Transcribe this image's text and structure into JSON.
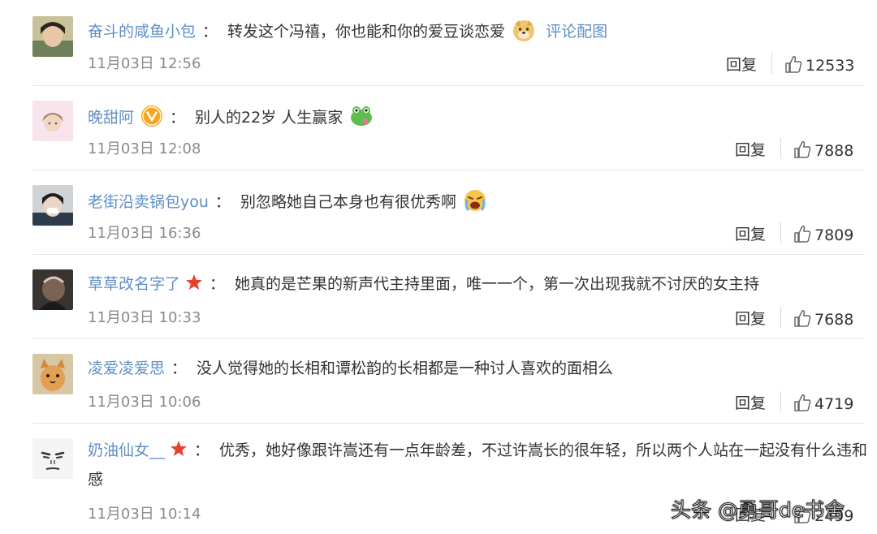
{
  "comments": [
    {
      "username": "奋斗的咸鱼小包",
      "colon": "：",
      "text": "转发这个冯禧，你也能和你的爱豆谈恋爱",
      "link": "评论配图",
      "time": "11月03日 12:56",
      "reply": "回复",
      "likes": "12533"
    },
    {
      "username": "晚甜阿",
      "colon": "：",
      "text": "别人的22岁 人生赢家",
      "time": "11月03日 12:08",
      "reply": "回复",
      "likes": "7888"
    },
    {
      "username": "老街沿卖锅包you",
      "colon": "：",
      "text": "别忽略她自己本身也有很优秀啊",
      "time": "11月03日 16:36",
      "reply": "回复",
      "likes": "7809"
    },
    {
      "username": "草草改名字了",
      "colon": "：",
      "text": "她真的是芒果的新声代主持里面，唯一一个，第一次出现我就不讨厌的女主持",
      "time": "11月03日 10:33",
      "reply": "回复",
      "likes": "7688"
    },
    {
      "username": "凌爱凌爱思",
      "colon": "：",
      "text": "没人觉得她的长相和谭松韵的长相都是一种讨人喜欢的面相么",
      "time": "11月03日 10:06",
      "reply": "回复",
      "likes": "4719"
    },
    {
      "username": "奶油仙女__",
      "colon": "：",
      "text": "优秀，她好像跟许嵩还有一点年龄差，不过许嵩长的很年轻，所以两个人站在一起没有什么违和感",
      "time": "11月03日 10:14",
      "reply": "回复",
      "likes": "2499"
    }
  ],
  "watermark": "头条 @勇哥de书舍",
  "icons": {
    "like": "thumbs-up-icon",
    "verified": "verified-v-icon",
    "member": "star-icon"
  },
  "colors": {
    "username": "#5f8fc4",
    "text": "#333333",
    "time": "#8a8a8a",
    "divider": "#e6e6e6",
    "star": "#e8412c",
    "verified": "#f5a623"
  }
}
